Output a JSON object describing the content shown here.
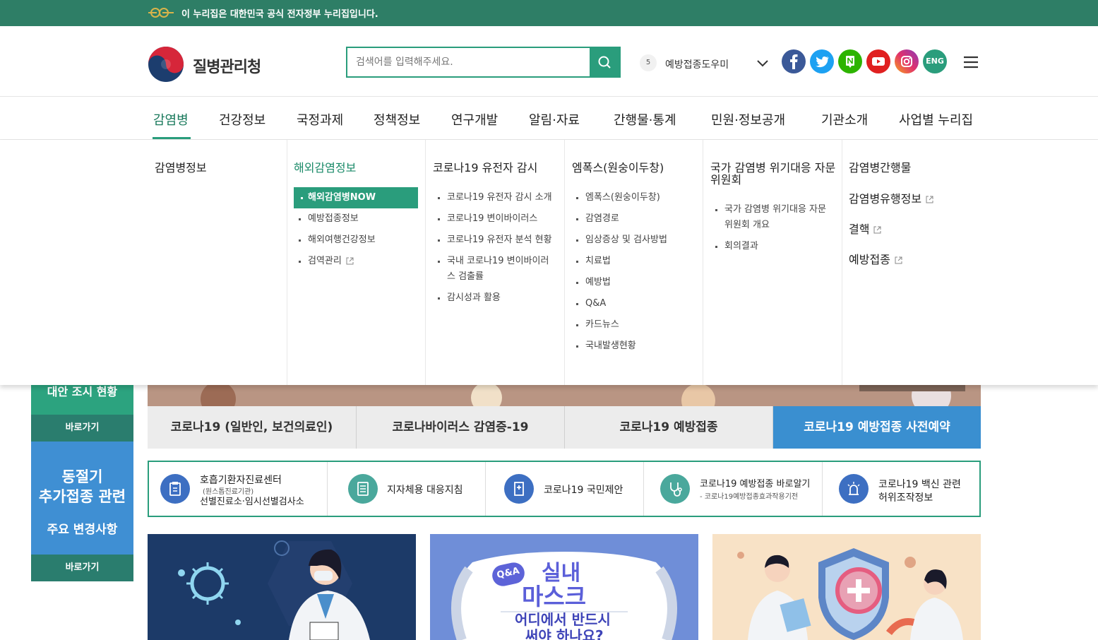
{
  "gov_bar": {
    "text": "이 누리집은 대한민국 공식 전자정부 누리집입니다."
  },
  "header": {
    "logo_text": "질병관리청",
    "search_placeholder": "검색어를 입력해주세요.",
    "helper_num": "5",
    "helper_label": "예방접종도우미",
    "sns": [
      "facebook-icon",
      "twitter-icon",
      "naver-post-icon",
      "youtube-icon",
      "instagram-icon"
    ],
    "eng": "ENG"
  },
  "gnb": [
    "감염병",
    "건강정보",
    "국정과제",
    "정책정보",
    "연구개발",
    "알림·자료",
    "간행물·통계",
    "민원·정보공개",
    "기관소개",
    "사업별 누리집"
  ],
  "mega": {
    "col1_title": "감염병정보",
    "col2_title": "해외감염정보",
    "col2_items": [
      "해외감염병NOW",
      "예방접종정보",
      "해외여행건강정보",
      "검역관리"
    ],
    "col3_title": "코로나19 유전자 감시",
    "col3_items": [
      "코로나19 유전자 감시 소개",
      "코로나19 변이바이러스",
      "코로나19 유전자 분석 현황",
      "국내 코로나19 변이바이러",
      "스 검출률",
      "감시성과 활용"
    ],
    "col4_title": "엠폭스(원숭이두창)",
    "col4_items": [
      "엠폭스(원숭이두창)",
      "감염경로",
      "임상증상 및 검사방법",
      "치료법",
      "예방법",
      "Q&A",
      "카드뉴스",
      "국내발생현황"
    ],
    "col5_title_1": "국가 감염병 위기대응 자문",
    "col5_title_2": "위원회",
    "col5_items": [
      "국가 감염병 위기대응 자문",
      "위원회 개요",
      "회의결과"
    ],
    "col6_title": "감염병간행물",
    "col6_links": [
      "감염병유행정보",
      "결핵",
      "예방접종"
    ]
  },
  "left_banners": {
    "b1_text": "대안 조시 현황",
    "goto1": "바로가기",
    "b2_line1": "동절기",
    "b2_line2": "추가접종 관련",
    "b2_line3": "주요 변경사항",
    "goto2": "바로가기"
  },
  "tabs": [
    "코로나19 (일반인, 보건의료인)",
    "코로나바이러스 감염증-19",
    "코로나19 예방접종",
    "코로나19 예방접종 사전예약"
  ],
  "quick": {
    "q1_l1": "호흡기환자진료센터",
    "q1_l2": "(원스톱진료기관)",
    "q1_l3": "선별진료소·임시선별검사소",
    "q2": "지자체용 대응지침",
    "q3": "코로나19 국민제안",
    "q4_l1": "코로나19 예방접종 바로알기",
    "q4_l2": "- 코로나19예방접종효과작용기전",
    "q5_l1": "코로나19 백신 관련",
    "q5_l2": "허위조작정보"
  },
  "cards": {
    "card2_badge": "Q&A",
    "card2_l1": "실내",
    "card2_l2": "마스크",
    "card2_l3": "어디에서 반드시",
    "card2_l4": "써야 하나요?"
  },
  "colors": {
    "green": "#2a9d7c",
    "gov": "#2e7e66",
    "blue": "#3a8fd0"
  }
}
